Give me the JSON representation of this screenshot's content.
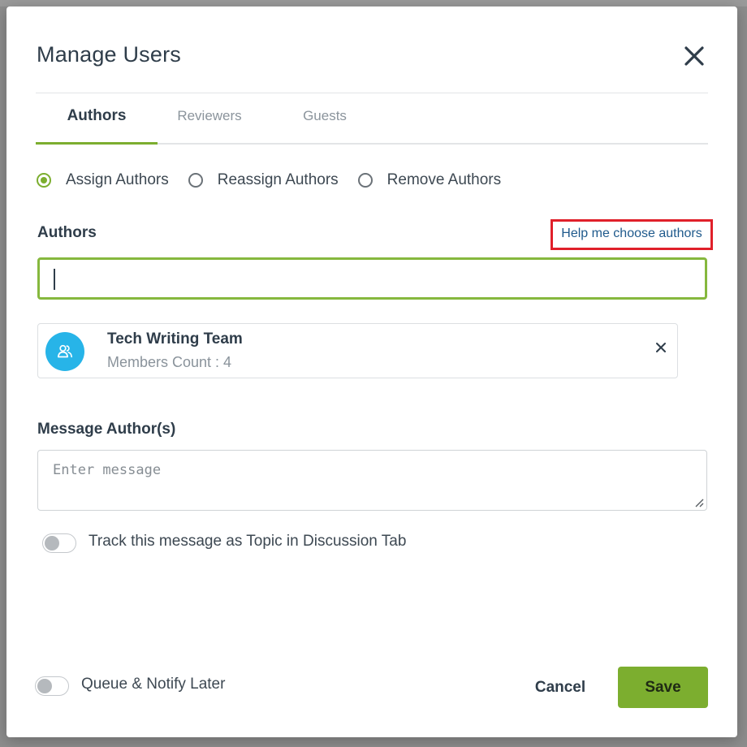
{
  "modal": {
    "title": "Manage Users"
  },
  "tabs": [
    {
      "label": "Authors",
      "active": true
    },
    {
      "label": "Reviewers",
      "active": false
    },
    {
      "label": "Guests",
      "active": false
    }
  ],
  "action_options": [
    {
      "label": "Assign Authors",
      "checked": true
    },
    {
      "label": "Reassign Authors",
      "checked": false
    },
    {
      "label": "Remove Authors",
      "checked": false
    }
  ],
  "authors": {
    "label": "Authors",
    "help_link": "Help me choose authors",
    "input_value": "",
    "selected": [
      {
        "name": "Tech Writing Team",
        "subtitle": "Members Count : 4"
      }
    ]
  },
  "message": {
    "label": "Message Author(s)",
    "placeholder": "Enter message",
    "value": ""
  },
  "track_toggle": {
    "label": "Track this message as Topic in Discussion Tab",
    "on": false
  },
  "queue_toggle": {
    "label": "Queue & Notify Later",
    "on": false
  },
  "footer": {
    "cancel_label": "Cancel",
    "save_label": "Save"
  },
  "colors": {
    "accent": "#7cae2f",
    "avatar": "#27b4e8",
    "highlight_border": "#e0202a",
    "link": "#1f5a8c"
  },
  "icons": {
    "close": "close-icon",
    "avatar": "user-group-icon",
    "chip_remove": "close-icon"
  }
}
